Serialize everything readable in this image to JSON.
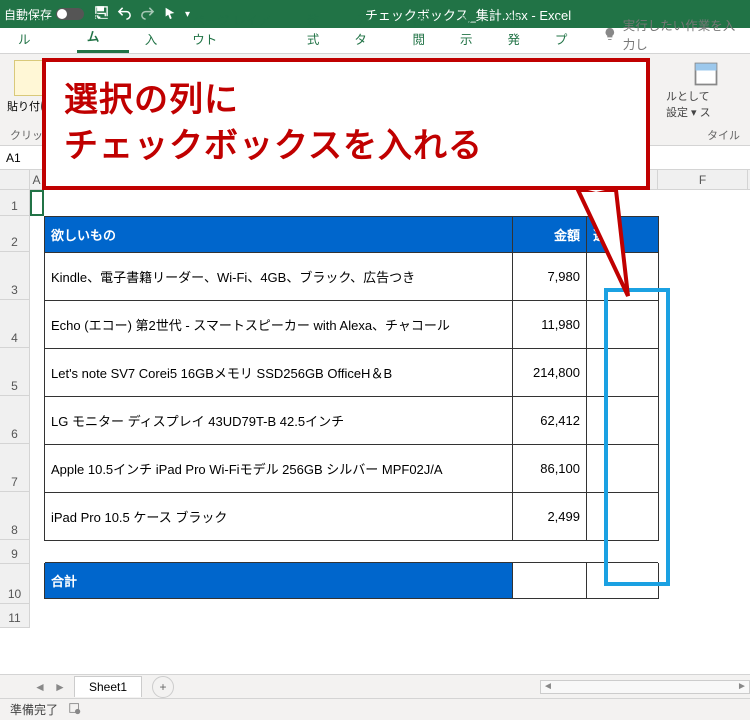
{
  "titlebar": {
    "autosave_label": "自動保存",
    "autosave_on": false,
    "title": "チェックボックス_集計.xlsx - Excel"
  },
  "tabs": {
    "file": "ファイル",
    "home": "ホーム",
    "insert": "挿入",
    "page_layout": "ページ レイアウト",
    "formulas": "数式",
    "data": "データ",
    "review": "校閲",
    "view": "表示",
    "developer": "開発",
    "help": "ヘルプ",
    "tell_me": "実行したい作業を入力し"
  },
  "ribbon": {
    "paste_label": "貼り付け",
    "clipboard_group": "クリップボ",
    "cellstyle_label1": "ルとして",
    "cellstyle_label2": "設定 ▾  ス",
    "styles_group": "タイル"
  },
  "namebox": {
    "ref": "A1"
  },
  "columns": [
    "A",
    "F"
  ],
  "callout": {
    "line1": "選択の列に",
    "line2": "チェックボックスを入れる"
  },
  "table": {
    "headers": {
      "desc": "欲しいもの",
      "amount": "金額",
      "select": "選択"
    },
    "rows": [
      {
        "desc": "Kindle、電子書籍リーダー、Wi-Fi、4GB、ブラック、広告つき",
        "amount": "7,980"
      },
      {
        "desc": "Echo (エコー) 第2世代 - スマートスピーカー with Alexa、チャコール",
        "amount": "11,980"
      },
      {
        "desc": "Let's note SV7 Corei5 16GBメモリ SSD256GB OfficeH＆B",
        "amount": "214,800"
      },
      {
        "desc": "LG モニター ディスプレイ 43UD79T-B 42.5インチ",
        "amount": "62,412"
      },
      {
        "desc": "Apple 10.5インチ iPad Pro Wi-Fiモデル 256GB シルバー MPF02J/A",
        "amount": "86,100"
      },
      {
        "desc": "iPad Pro 10.5 ケース ブラック",
        "amount": "2,499"
      }
    ],
    "total_label": "合計",
    "total_value": ""
  },
  "sheet": {
    "name": "Sheet1"
  },
  "statusbar": {
    "ready": "準備完了"
  }
}
